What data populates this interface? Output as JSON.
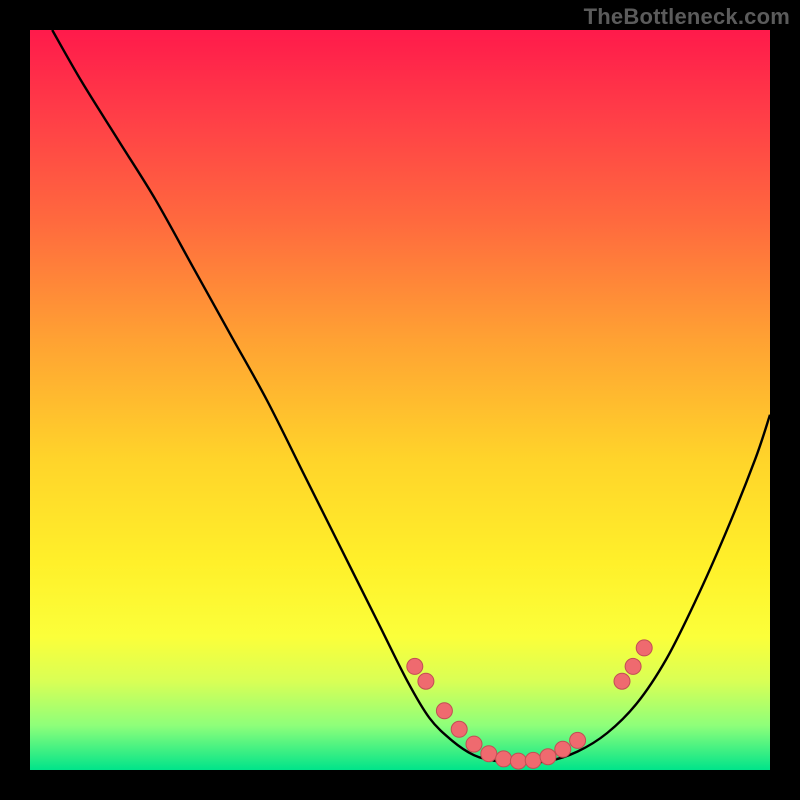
{
  "watermark": "TheBottleneck.com",
  "colors": {
    "frame": "#000000",
    "curve": "#000000",
    "dot_fill": "#ef6a6f",
    "dot_stroke": "#c14e54",
    "gradient_stops": [
      "#ff1a4b",
      "#ff3f47",
      "#ff6a3e",
      "#ffa233",
      "#ffd42a",
      "#fff02a",
      "#fbff3a",
      "#d9ff55",
      "#8eff7a",
      "#00e48a"
    ]
  },
  "chart_data": {
    "type": "line",
    "title": "",
    "xlabel": "",
    "ylabel": "",
    "grid": false,
    "xlim": [
      0,
      100
    ],
    "ylim": [
      0,
      100
    ],
    "curve": {
      "name": "bottleneck-curve",
      "x": [
        3,
        7,
        12,
        17,
        22,
        27,
        32,
        37,
        42,
        47,
        51,
        54,
        57,
        60,
        63,
        66,
        70,
        74,
        78,
        82,
        86,
        90,
        94,
        98,
        100
      ],
      "y": [
        100,
        93,
        85,
        77,
        68,
        59,
        50,
        40,
        30,
        20,
        12,
        7,
        4,
        2,
        1.2,
        1,
        1.2,
        2.5,
        5,
        9,
        15,
        23,
        32,
        42,
        48
      ]
    },
    "dots": {
      "name": "highlighted-points",
      "x": [
        52,
        53.5,
        56,
        58,
        60,
        62,
        64,
        66,
        68,
        70,
        72,
        74,
        80,
        81.5,
        83
      ],
      "y": [
        14,
        12,
        8,
        5.5,
        3.5,
        2.2,
        1.5,
        1.2,
        1.3,
        1.8,
        2.8,
        4,
        12,
        14,
        16.5
      ]
    }
  }
}
